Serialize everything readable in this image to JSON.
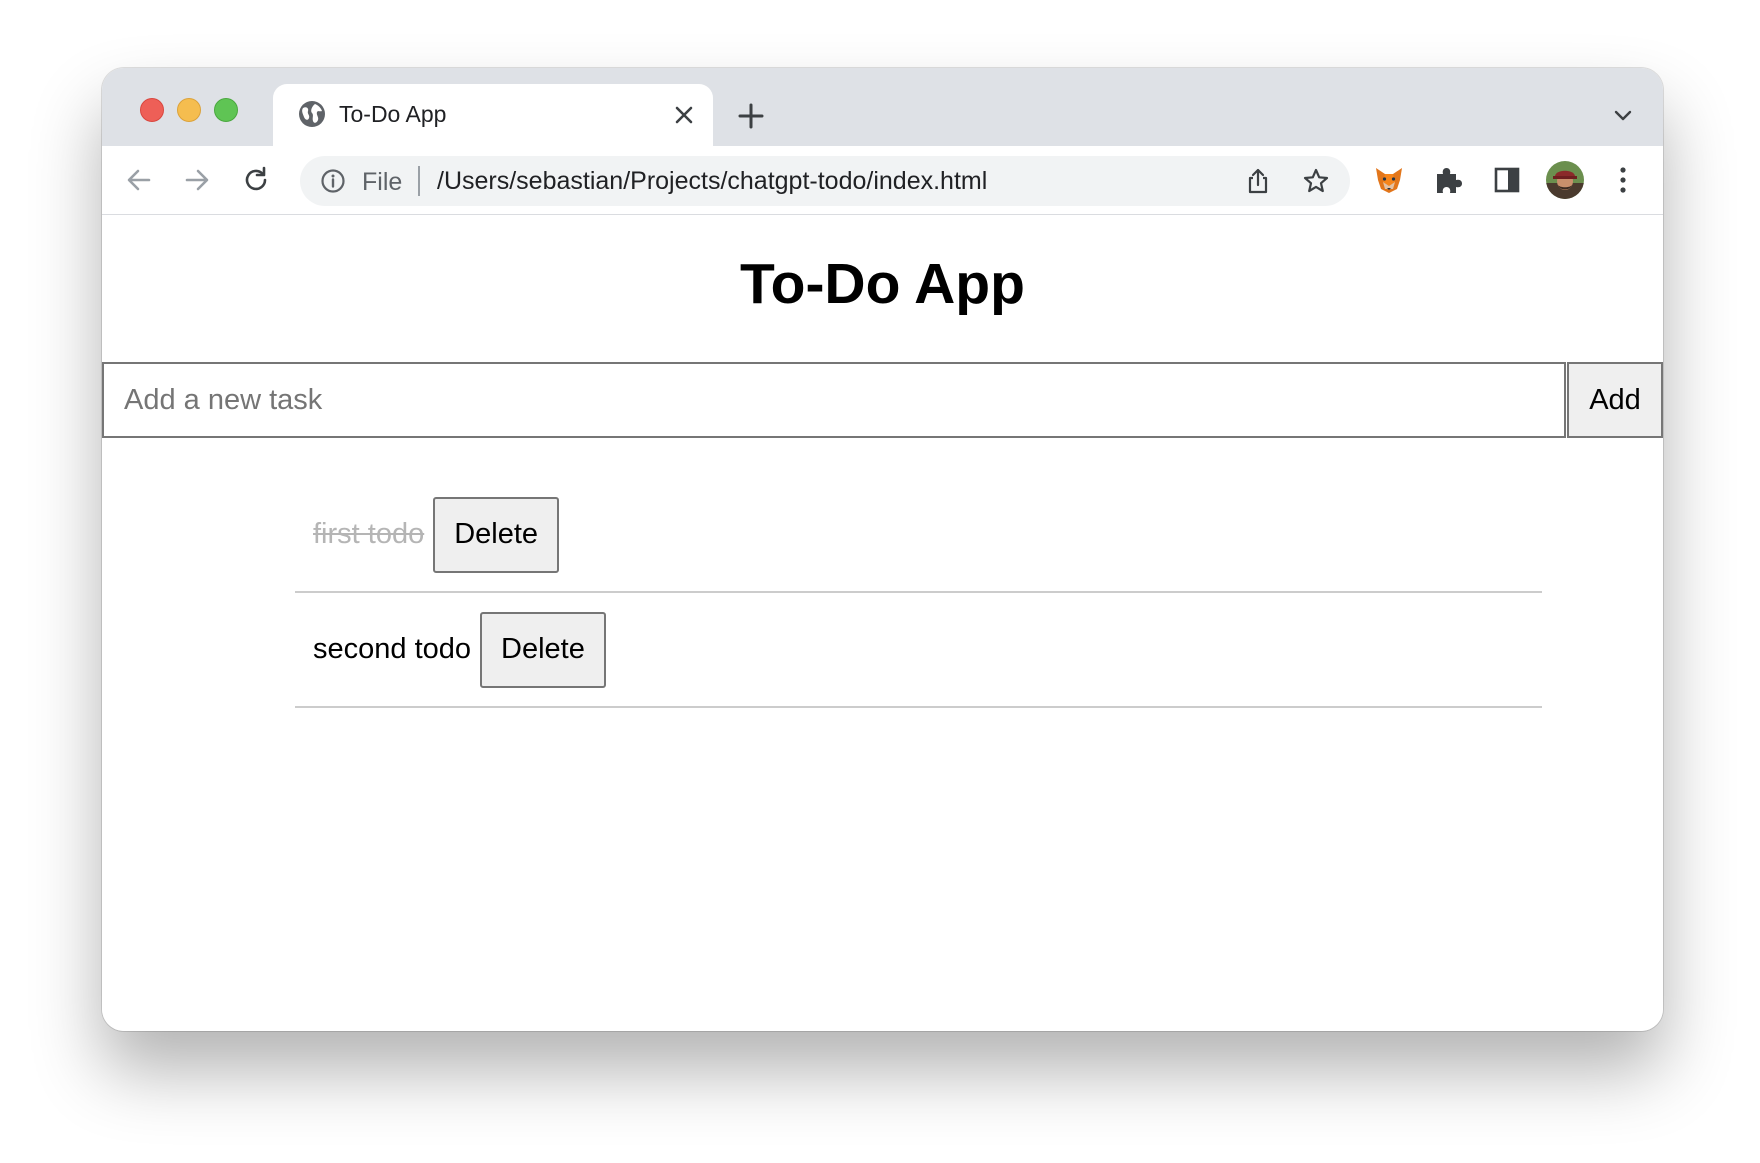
{
  "browser": {
    "tab": {
      "title": "To-Do App"
    },
    "omnibox": {
      "scheme_label": "File",
      "url": "/Users/sebastian/Projects/chatgpt-todo/index.html"
    },
    "icons": {
      "traffic_lights": [
        "close-red",
        "minimize-yellow",
        "zoom-green"
      ],
      "tab_favicon": "globe-icon",
      "extensions": [
        "fox-extension-icon",
        "puzzle-icon",
        "side-panel-icon"
      ],
      "avatar": "avatar"
    },
    "colors": {
      "tabstrip_bg": "#dee1e6",
      "omnibox_bg": "#f1f3f4",
      "red": "#ee5f57",
      "yellow": "#f5bd4f",
      "green": "#5fc454"
    }
  },
  "app": {
    "title": "To-Do App",
    "input": {
      "placeholder": "Add a new task",
      "value": ""
    },
    "add_label": "Add",
    "todos": [
      {
        "text": "first todo",
        "completed": true,
        "delete_label": "Delete"
      },
      {
        "text": "second todo",
        "completed": false,
        "delete_label": "Delete"
      }
    ],
    "colors": {
      "completed_text": "#b5b5b5",
      "button_bg": "#efefef",
      "divider": "#cccccc"
    }
  }
}
